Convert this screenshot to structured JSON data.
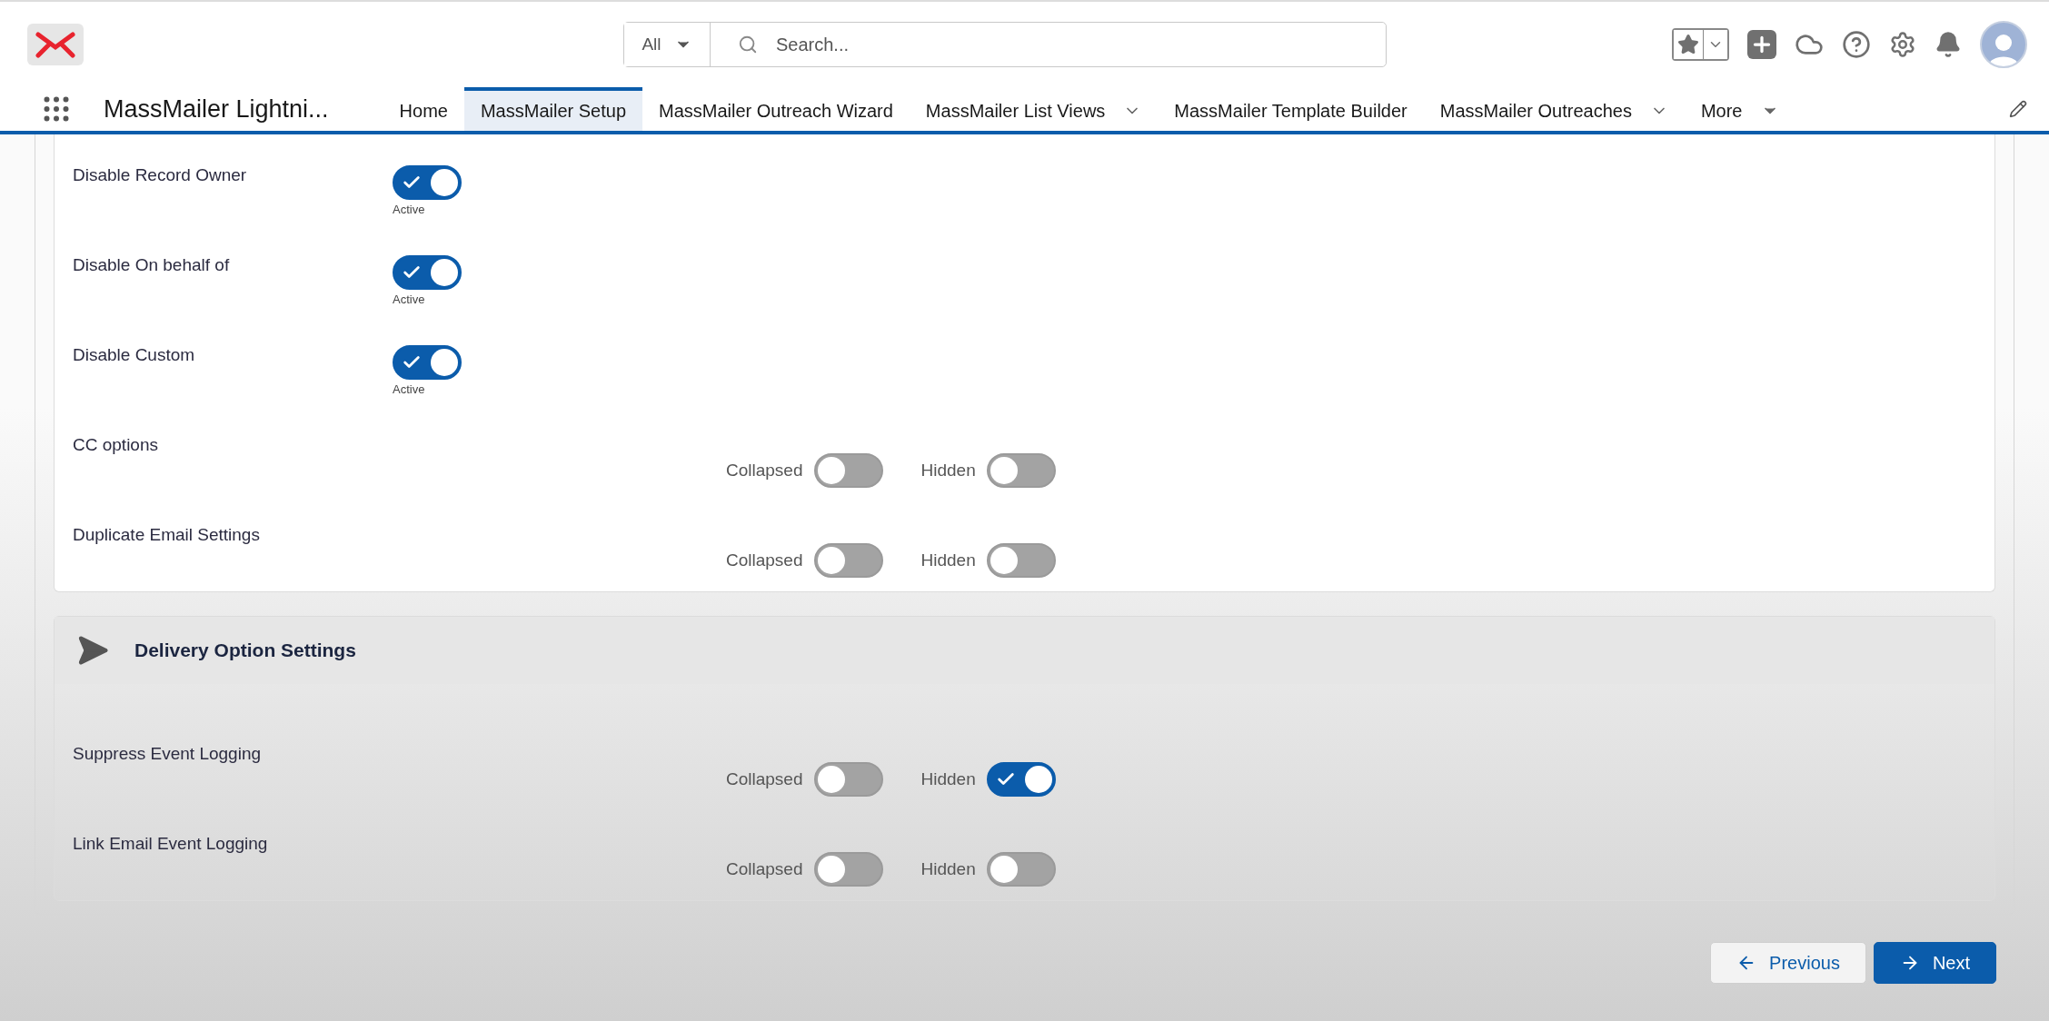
{
  "app": {
    "title": "MassMailer Lightni..."
  },
  "search": {
    "scope": "All",
    "placeholder": "Search..."
  },
  "nav": [
    {
      "label": "Home",
      "selected": false,
      "dropdown": false
    },
    {
      "label": "MassMailer Setup",
      "selected": true,
      "dropdown": false
    },
    {
      "label": "MassMailer Outreach Wizard",
      "selected": false,
      "dropdown": false
    },
    {
      "label": "MassMailer List Views",
      "selected": false,
      "dropdown": true
    },
    {
      "label": "MassMailer Template Builder",
      "selected": false,
      "dropdown": false
    },
    {
      "label": "MassMailer Outreaches",
      "selected": false,
      "dropdown": true
    }
  ],
  "more": "More",
  "sections": [
    {
      "rows": [
        {
          "kind": "single",
          "label": "Disable Record Owner",
          "on": true,
          "status": "Active"
        },
        {
          "kind": "single",
          "label": "Disable On behalf of",
          "on": true,
          "status": "Active"
        },
        {
          "kind": "single",
          "label": "Disable Custom",
          "on": true,
          "status": "Active"
        },
        {
          "kind": "dual",
          "label": "CC options",
          "controls": [
            {
              "label": "Collapsed",
              "on": false
            },
            {
              "label": "Hidden",
              "on": false
            }
          ]
        },
        {
          "kind": "dual",
          "label": "Duplicate Email Settings",
          "controls": [
            {
              "label": "Collapsed",
              "on": false
            },
            {
              "label": "Hidden",
              "on": false
            }
          ]
        }
      ]
    },
    {
      "title": "Delivery Option Settings",
      "rows": [
        {
          "kind": "dual",
          "label": "Suppress Event Logging",
          "controls": [
            {
              "label": "Collapsed",
              "on": false
            },
            {
              "label": "Hidden",
              "on": true
            }
          ]
        },
        {
          "kind": "dual",
          "label": "Link Email Event Logging",
          "controls": [
            {
              "label": "Collapsed",
              "on": false
            },
            {
              "label": "Hidden",
              "on": false
            }
          ]
        }
      ]
    }
  ],
  "buttons": [
    {
      "kind": "previous",
      "label": "Previous"
    },
    {
      "kind": "next",
      "label": "Next"
    }
  ]
}
